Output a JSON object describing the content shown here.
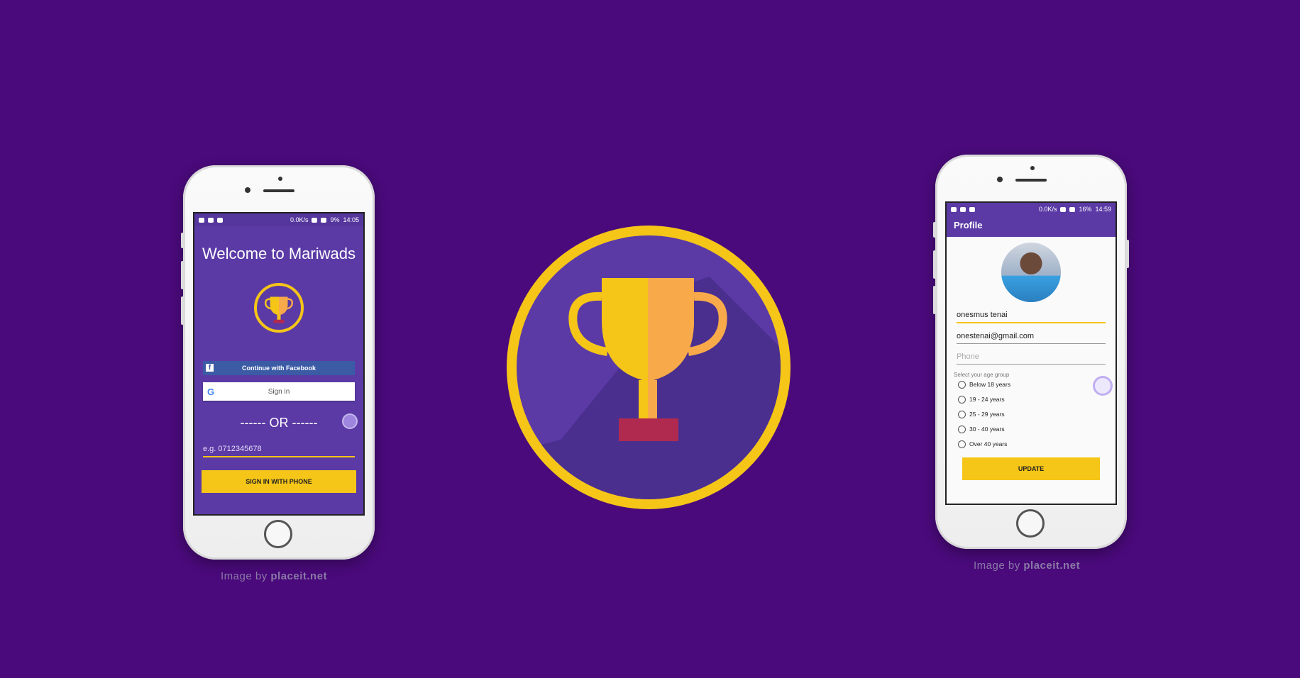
{
  "colors": {
    "background": "#4a0a7b",
    "screen_purple": "#5b3aa6",
    "accent_yellow": "#f5c518",
    "facebook_blue": "#3b5ba5",
    "trophy_base": "#b02a50"
  },
  "left_phone": {
    "status": {
      "speed": "0.0K/s",
      "battery": "9%",
      "time": "14:05"
    },
    "title": "Welcome to Mariwads",
    "logo_icon": "trophy-icon",
    "facebook_label": "Continue with Facebook",
    "google_label": "Sign in",
    "or_text": "------ OR ------",
    "phone_placeholder": "e.g. 0712345678",
    "sign_in_phone_label": "SIGN IN WITH PHONE",
    "credit_prefix": "Image by",
    "credit_site": "placeit.net"
  },
  "center_logo": {
    "icon": "trophy-icon"
  },
  "right_phone": {
    "status": {
      "speed": "0.0K/s",
      "battery": "16%",
      "time": "14:59"
    },
    "appbar_title": "Profile",
    "avatar_icon": "profile-photo",
    "name_value": "onesmus tenai",
    "email_value": "onestenai@gmail.com",
    "phone_placeholder": "Phone",
    "age_group_label": "Select your age group",
    "age_options": [
      "Below 18 years",
      "19 - 24 years",
      "25 - 29 years",
      "30 - 40 years",
      "Over 40 years"
    ],
    "update_label": "UPDATE",
    "credit_prefix": "Image by",
    "credit_site": "placeit.net"
  }
}
